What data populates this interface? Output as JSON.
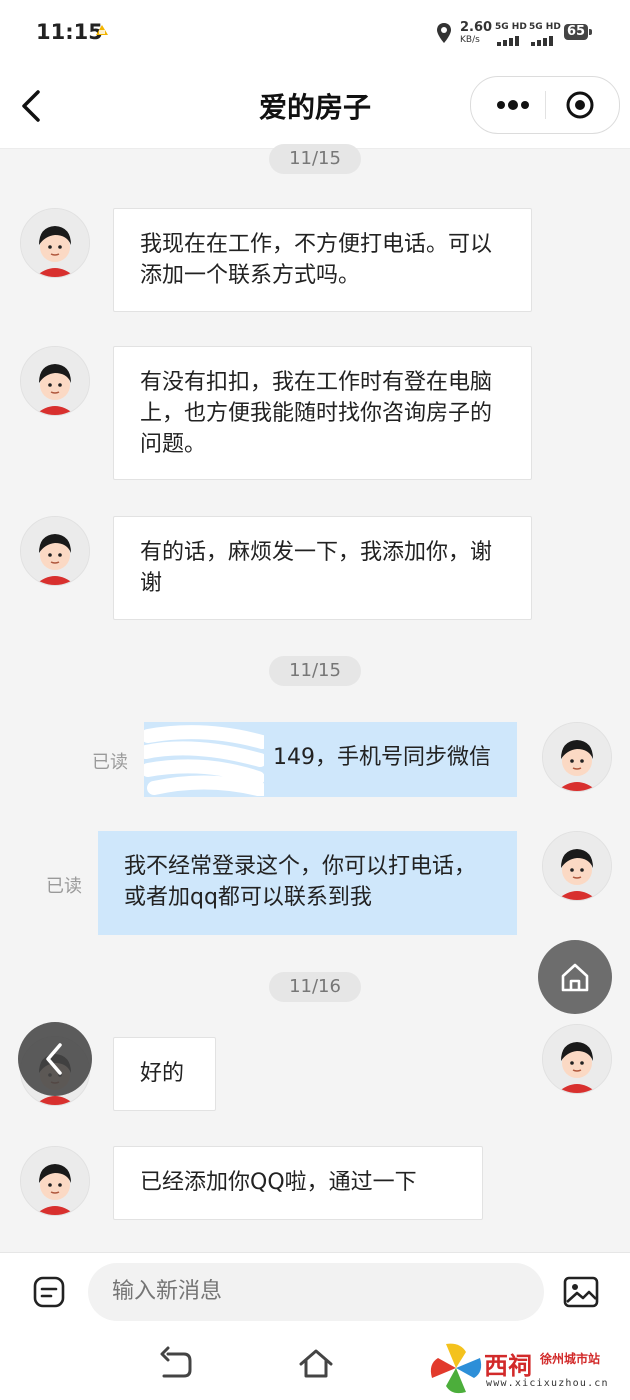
{
  "status_bar": {
    "time": "11:15",
    "speed_value": "2.60",
    "speed_unit": "KB/s",
    "net1": "5G HD",
    "net2": "5G HD",
    "battery": "65"
  },
  "header": {
    "back_icon": "chevron-left-icon",
    "title": "爱的房子",
    "more_icon": "more-dots-icon",
    "close_icon": "target-circle-icon"
  },
  "chat": {
    "dates": [
      "11/15",
      "11/15",
      "11/16"
    ],
    "messages": [
      {
        "side": "in",
        "text": "我现在在工作，不方便打电话。可以添加一个联系方式吗。"
      },
      {
        "side": "in",
        "text": "有没有扣扣，我在工作时有登在电脑上，也方便我能随时找你咨询房子的问题。"
      },
      {
        "side": "in",
        "text": "有的话，麻烦发一下，我添加你，谢谢"
      },
      {
        "side": "out",
        "status": "已读",
        "text": "149，手机号同步微信"
      },
      {
        "side": "out",
        "status": "已读",
        "text": "我不经常登录这个，你可以打电话，或者加qq都可以联系到我"
      },
      {
        "side": "in",
        "text": "好的"
      },
      {
        "side": "in",
        "text": "已经添加你QQ啦，通过一下"
      }
    ]
  },
  "floating": {
    "home_icon": "home-icon",
    "back_icon": "chevron-left-icon"
  },
  "composer": {
    "placeholder": "输入新消息",
    "left_icon": "message-icon",
    "right_icon": "image-icon"
  },
  "nav": {
    "back_icon": "back-arrow-icon",
    "home_icon": "home-outline-icon"
  },
  "watermark": {
    "brand": "西祠",
    "city": "徐州城市站",
    "url": "www.xicixuzhou.cn"
  }
}
